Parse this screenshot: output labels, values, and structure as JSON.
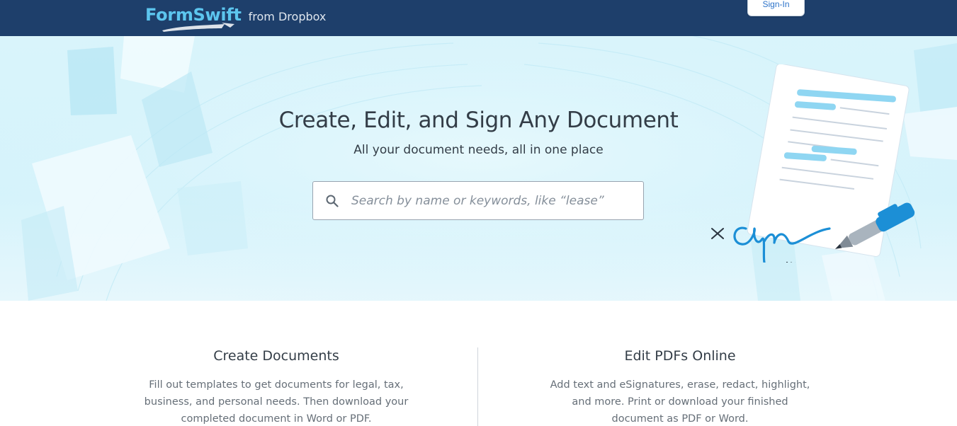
{
  "header": {
    "logo_text": "FormSwift",
    "logo_from": "from Dropbox",
    "signin_label": "Sign-In"
  },
  "hero": {
    "title": "Create, Edit, and Sign Any Document",
    "subtitle": "All your document needs, all in one place",
    "search_placeholder": "Search by name or keywords, like “lease”",
    "search_value": ""
  },
  "features": [
    {
      "title": "Create Documents",
      "body": "Fill out templates to get documents for legal, tax, business, and personal needs. Then download your completed document in Word or PDF."
    },
    {
      "title": "Edit PDFs Online",
      "body": "Add text and eSignatures, erase, redact, highlight, and more. Print or download your finished document as PDF or Word."
    }
  ],
  "colors": {
    "header_bg": "#1e3f6b",
    "logo_accent": "#5cc5ee",
    "hero_bg": "#d9f4fb",
    "link_blue": "#2c73c9",
    "text_dark": "#333d47",
    "text_muted": "#666f78"
  },
  "icons": {
    "search": "search-icon",
    "signature": "signature-illustration-icon",
    "pen": "pen-icon"
  }
}
